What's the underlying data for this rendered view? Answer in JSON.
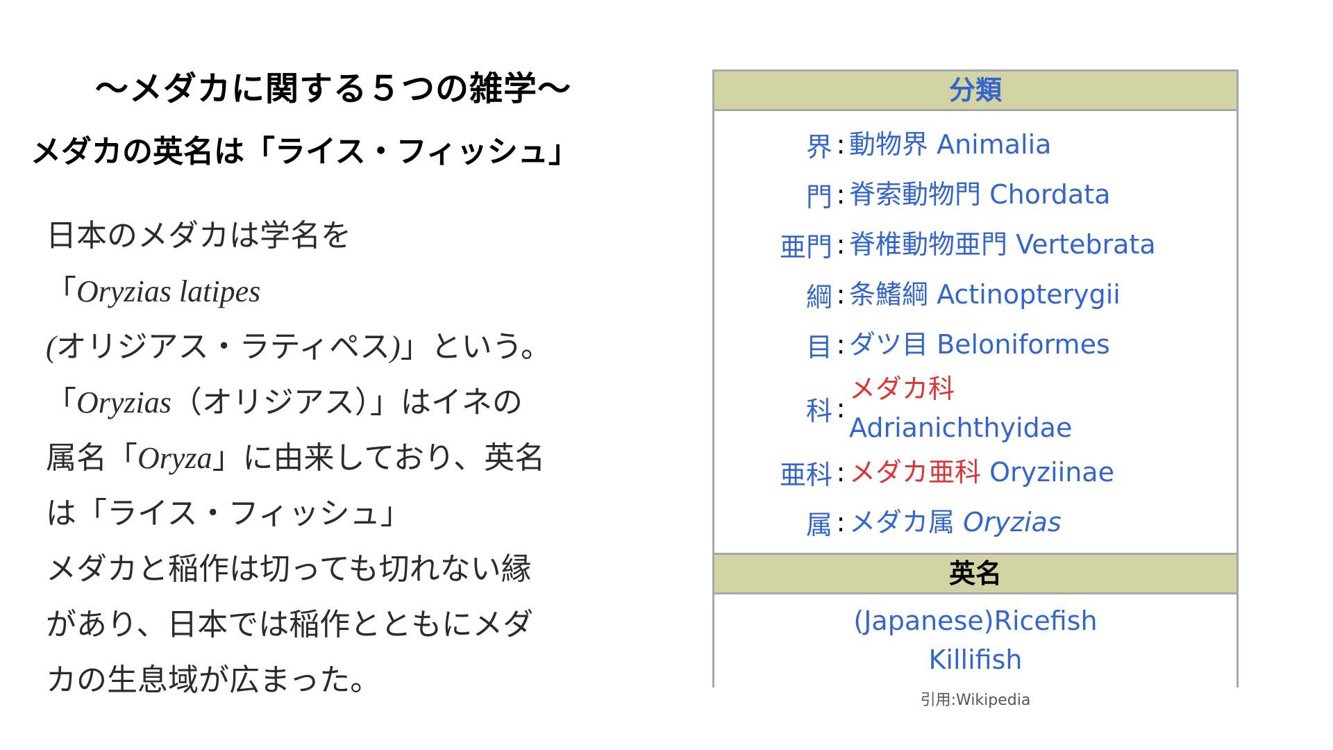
{
  "title": "〜メダカに関する５つの雑学〜",
  "subtitle": "メダカの英名は「ライス・フィッシュ」",
  "body": {
    "l1": "日本のメダカは学名を",
    "l2_pre": "「",
    "l2_italic": "Oryzias latipes",
    "l3_italic": "(",
    "l3_text": "オリジアス・ラティペス",
    "l3_italic2": ")",
    "l3_post": "」という。",
    "l4_pre": "「",
    "l4_italic": "Oryzias",
    "l4_post": "（オリジアス）」はイネの",
    "l5_pre": "属名「",
    "l5_italic": "Oryza",
    "l5_post": "」に由来しており、英名",
    "l6": "は「ライス・フィッシュ」",
    "l7": "メダカと稲作は切っても切れない縁",
    "l8": "があり、日本では稲作とともにメダ",
    "l9": "カの生息域が広まった。"
  },
  "taxonomy": {
    "header": "分類",
    "rows": [
      {
        "rank": "界",
        "value": "動物界 Animalia"
      },
      {
        "rank": "門",
        "value": "脊索動物門 Chordata"
      },
      {
        "rank": "亜門",
        "value": "脊椎動物亜門 Vertebrata"
      },
      {
        "rank": "綱",
        "value": "条鰭綱 Actinopterygii"
      },
      {
        "rank": "目",
        "value": "ダツ目 Beloniformes"
      },
      {
        "rank": "科",
        "value_red": "メダカ科",
        "value_blue": "Adrianichthyidae"
      },
      {
        "rank": "亜科",
        "value_red": "メダカ亜科",
        "value_blue": "Oryziinae"
      },
      {
        "rank": "属",
        "value": "メダカ属",
        "value_italic": "Oryzias"
      }
    ],
    "english_header": "英名",
    "english_names": [
      "(Japanese)Ricefish",
      "Killifish"
    ]
  },
  "colon": ":",
  "citation": "引用:Wikipedia",
  "colors": {
    "link_blue": "#3366cc",
    "link_red": "#dd3333",
    "header_bg": "#d3d3a4",
    "border": "#a2a9b1"
  }
}
